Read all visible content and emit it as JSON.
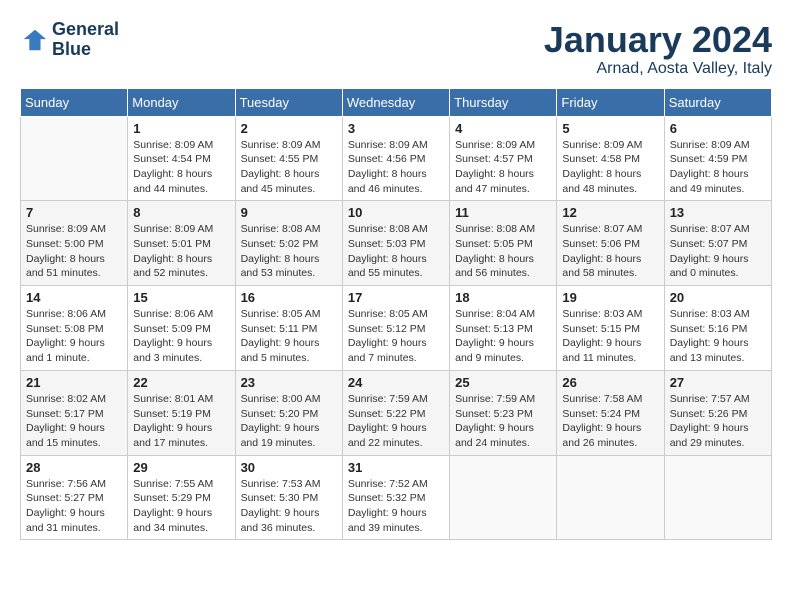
{
  "header": {
    "logo_line1": "General",
    "logo_line2": "Blue",
    "month": "January 2024",
    "location": "Arnad, Aosta Valley, Italy"
  },
  "weekdays": [
    "Sunday",
    "Monday",
    "Tuesday",
    "Wednesday",
    "Thursday",
    "Friday",
    "Saturday"
  ],
  "weeks": [
    [
      {
        "day": "",
        "info": ""
      },
      {
        "day": "1",
        "info": "Sunrise: 8:09 AM\nSunset: 4:54 PM\nDaylight: 8 hours\nand 44 minutes."
      },
      {
        "day": "2",
        "info": "Sunrise: 8:09 AM\nSunset: 4:55 PM\nDaylight: 8 hours\nand 45 minutes."
      },
      {
        "day": "3",
        "info": "Sunrise: 8:09 AM\nSunset: 4:56 PM\nDaylight: 8 hours\nand 46 minutes."
      },
      {
        "day": "4",
        "info": "Sunrise: 8:09 AM\nSunset: 4:57 PM\nDaylight: 8 hours\nand 47 minutes."
      },
      {
        "day": "5",
        "info": "Sunrise: 8:09 AM\nSunset: 4:58 PM\nDaylight: 8 hours\nand 48 minutes."
      },
      {
        "day": "6",
        "info": "Sunrise: 8:09 AM\nSunset: 4:59 PM\nDaylight: 8 hours\nand 49 minutes."
      }
    ],
    [
      {
        "day": "7",
        "info": "Sunrise: 8:09 AM\nSunset: 5:00 PM\nDaylight: 8 hours\nand 51 minutes."
      },
      {
        "day": "8",
        "info": "Sunrise: 8:09 AM\nSunset: 5:01 PM\nDaylight: 8 hours\nand 52 minutes."
      },
      {
        "day": "9",
        "info": "Sunrise: 8:08 AM\nSunset: 5:02 PM\nDaylight: 8 hours\nand 53 minutes."
      },
      {
        "day": "10",
        "info": "Sunrise: 8:08 AM\nSunset: 5:03 PM\nDaylight: 8 hours\nand 55 minutes."
      },
      {
        "day": "11",
        "info": "Sunrise: 8:08 AM\nSunset: 5:05 PM\nDaylight: 8 hours\nand 56 minutes."
      },
      {
        "day": "12",
        "info": "Sunrise: 8:07 AM\nSunset: 5:06 PM\nDaylight: 8 hours\nand 58 minutes."
      },
      {
        "day": "13",
        "info": "Sunrise: 8:07 AM\nSunset: 5:07 PM\nDaylight: 9 hours\nand 0 minutes."
      }
    ],
    [
      {
        "day": "14",
        "info": "Sunrise: 8:06 AM\nSunset: 5:08 PM\nDaylight: 9 hours\nand 1 minute."
      },
      {
        "day": "15",
        "info": "Sunrise: 8:06 AM\nSunset: 5:09 PM\nDaylight: 9 hours\nand 3 minutes."
      },
      {
        "day": "16",
        "info": "Sunrise: 8:05 AM\nSunset: 5:11 PM\nDaylight: 9 hours\nand 5 minutes."
      },
      {
        "day": "17",
        "info": "Sunrise: 8:05 AM\nSunset: 5:12 PM\nDaylight: 9 hours\nand 7 minutes."
      },
      {
        "day": "18",
        "info": "Sunrise: 8:04 AM\nSunset: 5:13 PM\nDaylight: 9 hours\nand 9 minutes."
      },
      {
        "day": "19",
        "info": "Sunrise: 8:03 AM\nSunset: 5:15 PM\nDaylight: 9 hours\nand 11 minutes."
      },
      {
        "day": "20",
        "info": "Sunrise: 8:03 AM\nSunset: 5:16 PM\nDaylight: 9 hours\nand 13 minutes."
      }
    ],
    [
      {
        "day": "21",
        "info": "Sunrise: 8:02 AM\nSunset: 5:17 PM\nDaylight: 9 hours\nand 15 minutes."
      },
      {
        "day": "22",
        "info": "Sunrise: 8:01 AM\nSunset: 5:19 PM\nDaylight: 9 hours\nand 17 minutes."
      },
      {
        "day": "23",
        "info": "Sunrise: 8:00 AM\nSunset: 5:20 PM\nDaylight: 9 hours\nand 19 minutes."
      },
      {
        "day": "24",
        "info": "Sunrise: 7:59 AM\nSunset: 5:22 PM\nDaylight: 9 hours\nand 22 minutes."
      },
      {
        "day": "25",
        "info": "Sunrise: 7:59 AM\nSunset: 5:23 PM\nDaylight: 9 hours\nand 24 minutes."
      },
      {
        "day": "26",
        "info": "Sunrise: 7:58 AM\nSunset: 5:24 PM\nDaylight: 9 hours\nand 26 minutes."
      },
      {
        "day": "27",
        "info": "Sunrise: 7:57 AM\nSunset: 5:26 PM\nDaylight: 9 hours\nand 29 minutes."
      }
    ],
    [
      {
        "day": "28",
        "info": "Sunrise: 7:56 AM\nSunset: 5:27 PM\nDaylight: 9 hours\nand 31 minutes."
      },
      {
        "day": "29",
        "info": "Sunrise: 7:55 AM\nSunset: 5:29 PM\nDaylight: 9 hours\nand 34 minutes."
      },
      {
        "day": "30",
        "info": "Sunrise: 7:53 AM\nSunset: 5:30 PM\nDaylight: 9 hours\nand 36 minutes."
      },
      {
        "day": "31",
        "info": "Sunrise: 7:52 AM\nSunset: 5:32 PM\nDaylight: 9 hours\nand 39 minutes."
      },
      {
        "day": "",
        "info": ""
      },
      {
        "day": "",
        "info": ""
      },
      {
        "day": "",
        "info": ""
      }
    ]
  ]
}
